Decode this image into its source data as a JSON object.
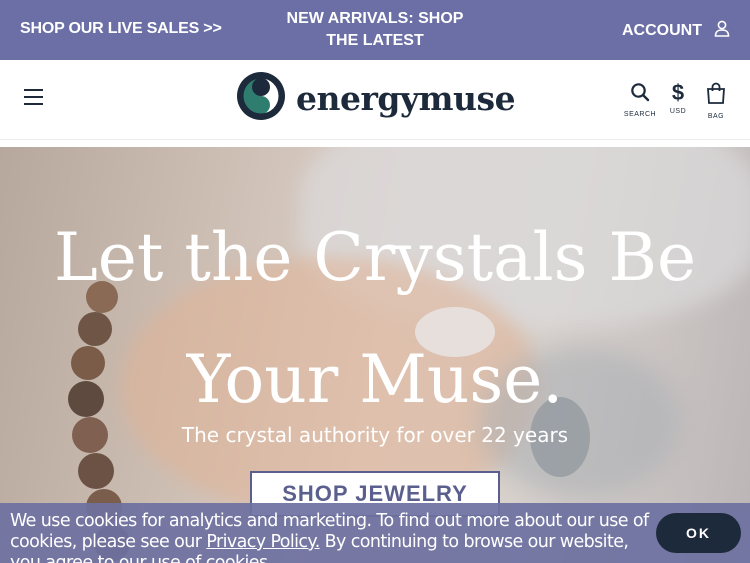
{
  "announcement": {
    "left_link": "SHOP OUR LIVE SALES >>",
    "center_link": "NEW ARRIVALS: SHOP THE LATEST",
    "account_label": "ACCOUNT",
    "account_icon": "user-icon"
  },
  "header": {
    "menu_icon": "hamburger-menu-icon",
    "logo_text": "energymuse",
    "search_label": "SEARCH",
    "currency_symbol": "$",
    "currency_label": "USD",
    "bag_label": "BAG"
  },
  "hero": {
    "title_line1": "Let the Crystals Be",
    "title_line2": "Your Muse.",
    "subtitle": "The crystal authority for over 22 years",
    "button_label": "SHOP JEWELRY"
  },
  "cookie": {
    "text_before": "We use cookies for analytics and marketing. To find out more about our use of cookies, please see our ",
    "link_text": "Privacy Policy.",
    "text_after": " By continuing to browse our website, you agree to our use of cookies.",
    "ok_label": "OK"
  },
  "colors": {
    "brand_purple": "#6b6fa6",
    "navy": "#1d2a3c",
    "logo_teal": "#2f7d6e"
  }
}
